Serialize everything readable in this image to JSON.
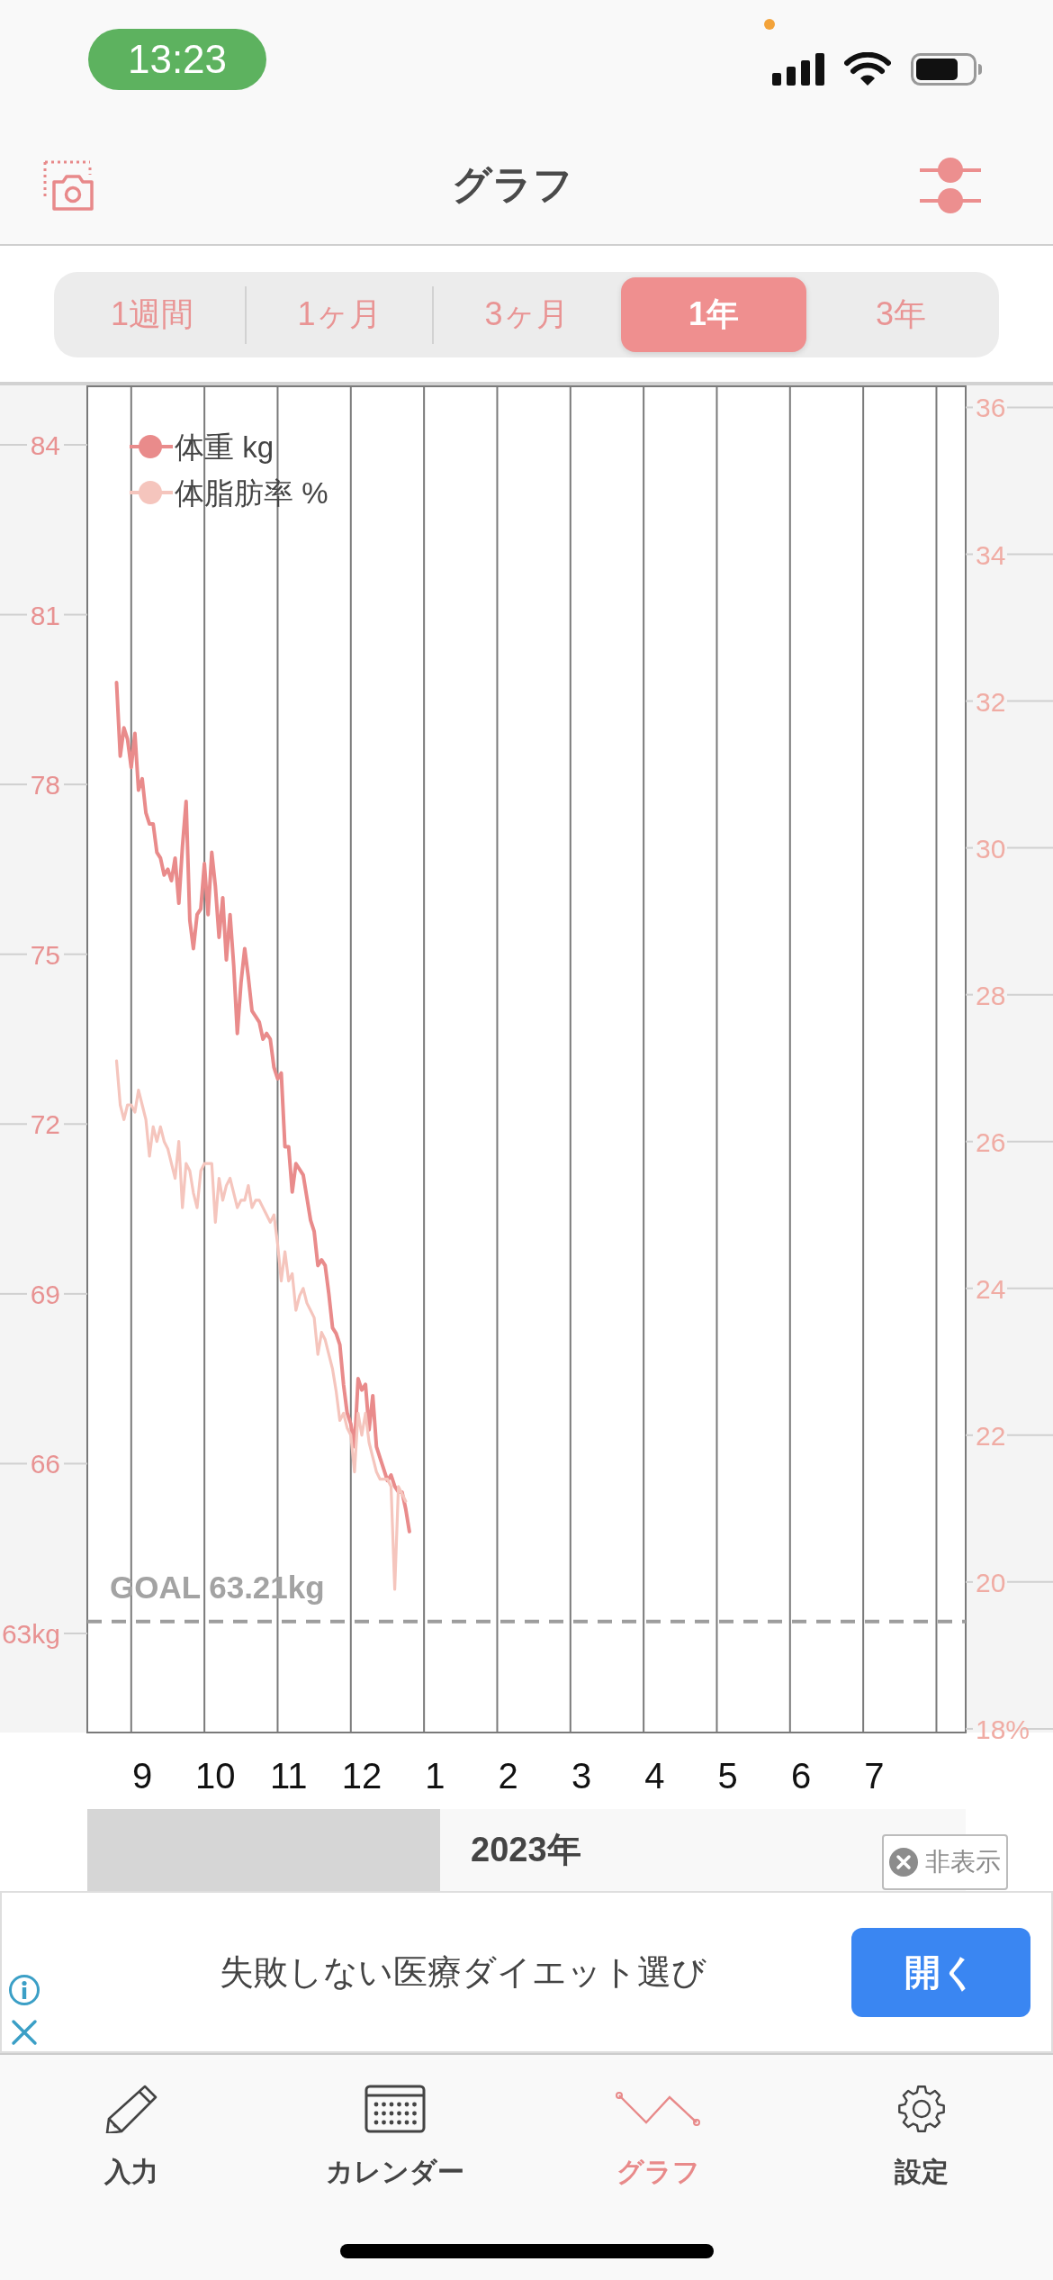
{
  "status_bar": {
    "time": "13:23"
  },
  "nav_bar": {
    "title": "グラフ"
  },
  "period_tabs": [
    {
      "label": "1週間",
      "selected": false
    },
    {
      "label": "1ヶ月",
      "selected": false
    },
    {
      "label": "3ヶ月",
      "selected": false
    },
    {
      "label": "1年",
      "selected": true
    },
    {
      "label": "3年",
      "selected": false
    }
  ],
  "chart": {
    "chart_data": {
      "type": "line",
      "legend": "upper left",
      "categories": [
        null,
        null,
        null,
        null,
        null,
        null,
        null,
        null,
        null,
        null,
        null,
        null,
        null,
        null,
        null,
        "9",
        null,
        null,
        null,
        null,
        null,
        null,
        null,
        null,
        null,
        null,
        null,
        null,
        null,
        null,
        null,
        null,
        null,
        null,
        null,
        "10",
        null,
        null,
        null,
        null,
        null,
        null,
        null,
        null,
        null,
        null,
        null,
        null,
        null,
        null,
        null,
        null,
        null,
        null,
        null,
        "11",
        null,
        null,
        null,
        null,
        null,
        null,
        null,
        null,
        null,
        null,
        null,
        null,
        null,
        null,
        null,
        null,
        null,
        null,
        null,
        "12",
        null,
        null,
        null,
        null,
        null,
        null,
        null,
        null,
        null,
        null,
        null,
        null,
        null,
        null,
        null,
        null,
        null,
        null,
        null,
        "1",
        null,
        null,
        null,
        null,
        null,
        null,
        null,
        null,
        null,
        null,
        null,
        null,
        null,
        null,
        null,
        null,
        null,
        null,
        null,
        "2",
        null,
        null,
        null,
        null,
        null,
        null,
        null,
        null,
        null,
        null,
        null,
        null,
        null,
        null,
        null,
        null,
        null,
        null,
        null,
        "3",
        null,
        null,
        null,
        null,
        null,
        null,
        null,
        null,
        null,
        null,
        null,
        null,
        null,
        null,
        null,
        null,
        null,
        null,
        null,
        "4",
        null,
        null,
        null,
        null,
        null,
        null,
        null,
        null,
        null,
        null,
        null,
        null,
        null,
        null,
        null,
        null,
        null,
        null,
        null,
        "5",
        null,
        null,
        null,
        null,
        null,
        null,
        null,
        null,
        null,
        null,
        null,
        null,
        null,
        null,
        null,
        null,
        null,
        null,
        null,
        "6",
        null,
        null,
        null,
        null,
        null,
        null,
        null,
        null,
        null,
        null,
        null,
        null,
        null,
        null,
        null,
        null,
        null,
        null,
        null,
        "7",
        null,
        null,
        null,
        null,
        null,
        null,
        null,
        null,
        null,
        null,
        null,
        null,
        null,
        null,
        null,
        null,
        null,
        null,
        null,
        null,
        null,
        null,
        null,
        null,
        null
      ],
      "series": [
        {
          "name": "体重 kg",
          "color": "#e98b8b",
          "values": [
            null,
            null,
            null,
            null,
            null,
            null,
            null,
            null,
            79.8,
            78.5,
            79.0,
            78.8,
            78.3,
            78.9,
            77.9,
            78.1,
            77.5,
            77.3,
            77.3,
            76.8,
            76.7,
            76.4,
            76.5,
            76.3,
            76.7,
            75.9,
            76.9,
            77.7,
            75.6,
            75.1,
            75.7,
            75.8,
            76.6,
            75.7,
            76.8,
            76.2,
            75.3,
            76.0,
            74.9,
            75.7,
            74.8,
            73.6,
            74.5,
            75.1,
            74.6,
            74.0,
            73.9,
            73.8,
            73.5,
            73.6,
            73.5,
            73.0,
            72.8,
            72.9,
            71.6,
            71.6,
            70.8,
            71.3,
            71.2,
            71.1,
            70.7,
            70.3,
            70.1,
            69.5,
            69.6,
            69.5,
            69.0,
            68.4,
            68.3,
            68.1,
            67.4,
            66.9,
            66.7,
            66.3,
            67.5,
            67.3,
            67.4,
            66.6,
            67.2,
            66.3,
            66.1,
            65.9,
            65.7,
            65.8,
            65.6,
            65.5,
            65.5,
            65.2,
            64.8,
            null,
            null,
            null,
            null,
            null,
            null,
            null,
            null,
            null,
            null,
            null,
            null,
            null,
            null,
            null,
            null,
            null,
            null,
            null,
            null,
            null,
            null,
            null,
            null,
            null,
            null,
            null,
            null,
            null,
            null,
            null,
            null,
            null,
            null,
            null,
            null,
            null,
            null,
            null,
            null,
            null,
            null,
            null,
            null,
            null,
            null,
            null,
            null,
            null,
            null,
            null,
            null,
            null,
            null,
            null,
            null,
            null,
            null,
            null,
            null,
            null,
            null,
            null,
            null,
            null,
            null,
            null,
            null,
            null,
            null,
            null,
            null,
            null,
            null,
            null,
            null,
            null,
            null,
            null,
            null,
            null,
            null,
            null,
            null,
            null,
            null,
            null,
            null,
            null,
            null,
            null,
            null,
            null,
            null,
            null,
            null,
            null,
            null,
            null,
            null,
            null,
            null,
            null,
            null,
            null,
            null,
            null,
            null,
            null,
            null,
            null,
            null,
            null,
            null,
            null,
            null,
            null,
            null,
            null,
            null,
            null,
            null,
            null,
            null,
            null,
            null,
            null,
            null,
            null,
            null,
            null,
            null,
            null,
            null,
            null,
            null,
            null,
            null,
            null,
            null,
            null,
            null,
            null,
            null,
            null,
            null,
            null,
            null,
            null,
            null,
            null,
            null
          ]
        },
        {
          "name": "体脂肪率 %",
          "color": "#f5c5bd",
          "axis": "y2",
          "values": [
            null,
            null,
            null,
            null,
            null,
            null,
            null,
            null,
            27.1,
            26.5,
            26.3,
            26.5,
            26.5,
            26.4,
            26.7,
            26.5,
            26.3,
            25.8,
            26.2,
            26.0,
            26.2,
            26.0,
            25.9,
            25.7,
            25.5,
            26.0,
            25.1,
            25.7,
            25.6,
            25.3,
            25.1,
            25.6,
            25.7,
            25.7,
            25.7,
            24.9,
            25.5,
            25.2,
            25.4,
            25.5,
            25.3,
            25.1,
            25.2,
            25.2,
            25.4,
            25.1,
            25.2,
            25.2,
            25.1,
            25.0,
            24.9,
            25.0,
            24.6,
            24.1,
            24.5,
            24.1,
            24.2,
            23.7,
            23.9,
            24.0,
            23.8,
            23.7,
            23.6,
            23.1,
            23.4,
            23.3,
            23.1,
            22.9,
            22.6,
            22.2,
            22.3,
            22.1,
            22.0,
            21.5,
            22.3,
            22.0,
            22.3,
            21.9,
            21.7,
            21.5,
            21.4,
            21.4,
            21.4,
            21.3,
            19.9,
            21.3,
            21.2,
            21.1,
            null,
            null,
            null,
            null,
            null,
            null,
            null,
            null,
            null,
            null,
            null,
            null,
            null,
            null,
            null,
            null,
            null,
            null,
            null,
            null,
            null,
            null,
            null,
            null,
            null,
            null,
            null,
            null,
            null,
            null,
            null,
            null,
            null,
            null,
            null,
            null,
            null,
            null,
            null,
            null,
            null,
            null,
            null,
            null,
            null,
            null,
            null,
            null,
            null,
            null,
            null,
            null,
            null,
            null,
            null,
            null,
            null,
            null,
            null,
            null,
            null,
            null,
            null,
            null,
            null,
            null,
            null,
            null,
            null,
            null,
            null,
            null,
            null,
            null,
            null,
            null,
            null,
            null,
            null,
            null,
            null,
            null,
            null,
            null,
            null,
            null,
            null,
            null,
            null,
            null,
            null,
            null,
            null,
            null,
            null,
            null,
            null,
            null,
            null,
            null,
            null,
            null,
            null,
            null,
            null,
            null,
            null,
            null,
            null,
            null,
            null,
            null,
            null,
            null,
            null,
            null,
            null,
            null,
            null,
            null,
            null,
            null,
            null,
            null,
            null,
            null,
            null,
            null,
            null,
            null,
            null,
            null,
            null,
            null,
            null,
            null,
            null,
            null,
            null,
            null,
            null,
            null,
            null,
            null,
            null,
            null,
            null,
            null,
            null,
            null,
            null,
            null,
            null
          ]
        }
      ],
      "ylim": [
        61.25,
        85.05
      ],
      "yticks": [
        84,
        81,
        78,
        75,
        72,
        69,
        66,
        {
          "value": 63,
          "label": "63kg"
        }
      ],
      "y2lim": [
        17.95,
        36.3
      ],
      "y2ticks": [
        36,
        34,
        32,
        30,
        28,
        26,
        24,
        22,
        20,
        {
          "value": 18,
          "label": "18%"
        }
      ],
      "ref_lines": [
        {
          "axis": "y",
          "value": 63.21,
          "label": "GOAL 63.21kg"
        }
      ]
    }
  },
  "year_band": {
    "label": "2023年"
  },
  "ad": {
    "hide_label": "非表示",
    "text": "失敗しない医療ダイエット選び",
    "button": "開く"
  },
  "tab_bar": [
    {
      "label": "入力",
      "selected": false
    },
    {
      "label": "カレンダー",
      "selected": false
    },
    {
      "label": "グラフ",
      "selected": true
    },
    {
      "label": "設定",
      "selected": false
    }
  ]
}
